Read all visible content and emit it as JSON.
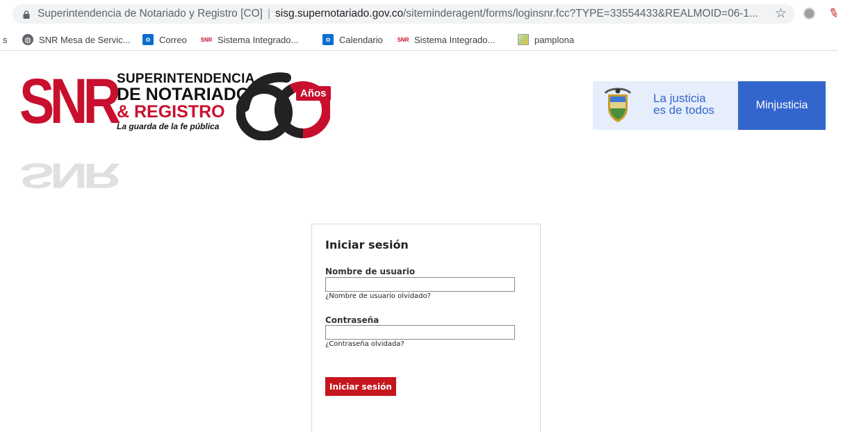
{
  "browser": {
    "page_title": "Superintendencia de Notariado y Registro [CO]",
    "url_domain": "sisg.supernotariado.gov.co",
    "url_path": "/siteminderagent/forms/loginsnr.fcc?TYPE=33554433&REALMOID=06-1..."
  },
  "bookmarks": {
    "truncated_edge": "s",
    "items": [
      {
        "label": "SNR Mesa de Servic...",
        "icon": "globe-icon"
      },
      {
        "label": "Correo",
        "icon": "outlook-icon"
      },
      {
        "label": "Sistema Integrado...",
        "icon": "snr-favicon"
      },
      {
        "label": "Calendario",
        "icon": "outlook-icon"
      },
      {
        "label": "Sistema Integrado...",
        "icon": "snr-favicon"
      },
      {
        "label": "pamplona",
        "icon": "image-icon"
      }
    ]
  },
  "logo": {
    "letters": "SNR",
    "line1": "SUPERINTENDENCIA",
    "line2": "DE NOTARIADO",
    "line3": "& REGISTRO",
    "tagline": "La guarda de la fe pública",
    "anniversary_number": "60",
    "anniversary_word": "Años",
    "brand_red": "#c8102e"
  },
  "gov_banner": {
    "slogan_line1": "La justicia",
    "slogan_line2": "es de todos",
    "ministry": "Minjusticia",
    "blue": "#3366cc",
    "light_blue": "#e5eefa"
  },
  "login": {
    "title": "Iniciar sesión",
    "username_label": "Nombre de usuario",
    "username_value": "",
    "forgot_username": "¿Nombre de usuario olvidado?",
    "password_label": "Contraseña",
    "password_value": "",
    "forgot_password": "¿Contraseña olvidada?",
    "submit_label": "Iniciar sesión",
    "submit_color": "#c5151d"
  }
}
